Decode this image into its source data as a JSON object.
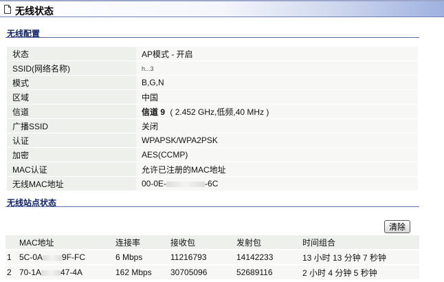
{
  "page": {
    "title": "无线状态"
  },
  "wireless_config": {
    "section_title": "无线配置",
    "rows": [
      {
        "key": "状态",
        "value": "AP模式 - 开启"
      },
      {
        "key": "SSID(网络名称)",
        "value": "h...3"
      },
      {
        "key": "模式",
        "value": "B,G,N"
      },
      {
        "key": "区域",
        "value": "中国"
      },
      {
        "key": "信道",
        "value_bold": "信道 9",
        "value": "( 2.452 GHz,低频,40 MHz )"
      },
      {
        "key": "广播SSID",
        "value": "关闭"
      },
      {
        "key": "认证",
        "value": "WPAPSK/WPA2PSK"
      },
      {
        "key": "加密",
        "value": "AES(CCMP)"
      },
      {
        "key": "MAC认证",
        "value": "允许已注册的MAC地址"
      },
      {
        "key": "无线MAC地址",
        "value_prefix": "00-0E-",
        "value_suffix": "-6C"
      }
    ]
  },
  "station_status": {
    "section_title": "无线站点状态",
    "clear_button": "清除",
    "columns": [
      "MAC地址",
      "连接率",
      "接收包",
      "发射包",
      "时间组合"
    ],
    "rows": [
      {
        "index": "1",
        "mac_prefix": "5C-0A",
        "mac_suffix": "9F-FC",
        "rate": "6 Mbps",
        "rx": "11216793",
        "tx": "14142233",
        "time": "13 小时 13 分钟 7 秒钟"
      },
      {
        "index": "2",
        "mac_prefix": "70-1A",
        "mac_suffix": "47-4A",
        "rate": "162 Mbps",
        "rx": "30705096",
        "tx": "52689116",
        "time": "2 小时 4 分钟 5 秒钟"
      }
    ]
  }
}
